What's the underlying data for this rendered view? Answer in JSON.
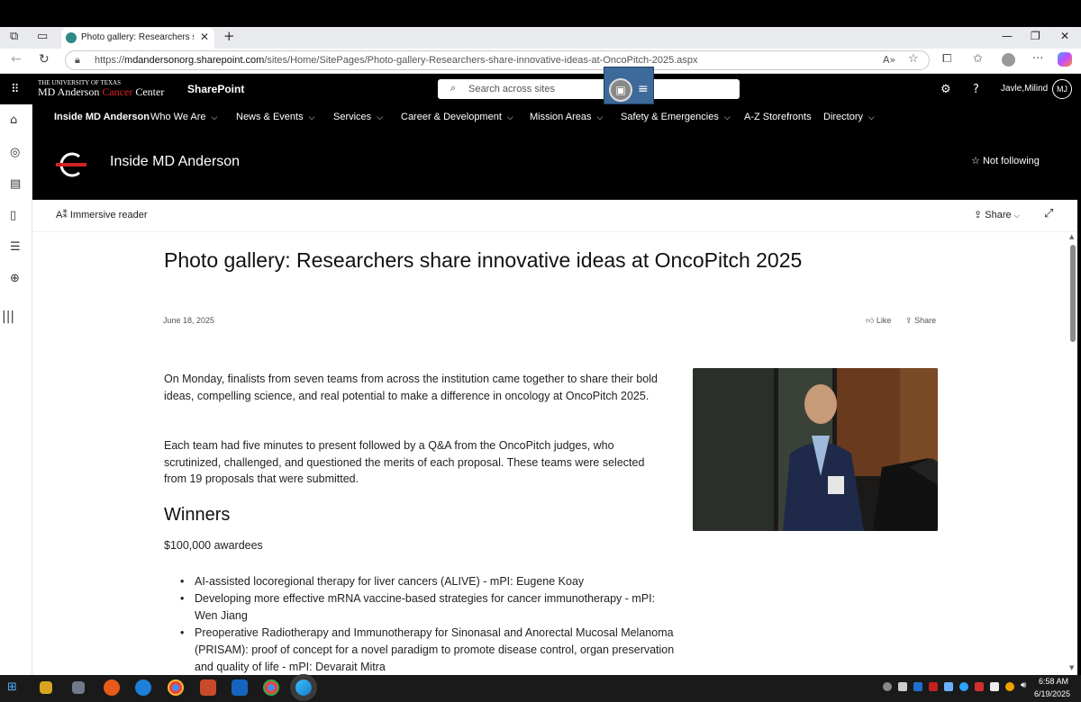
{
  "browser": {
    "tab_title": "Photo gallery: Researchers share i",
    "url_prefix": "https://",
    "url_domain": "mdandersonorg.sharepoint.com",
    "url_path": "/sites/Home/SitePages/Photo-gallery-Researchers-share-innovative-ideas-at-OncoPitch-2025.aspx"
  },
  "suite": {
    "logo_small": "THE UNIVERSITY OF TEXAS",
    "logo_md": "MD Anderson ",
    "logo_cancer": "Cancer",
    "logo_center": " Center",
    "app_name": "SharePoint",
    "search_placeholder": "Search across sites",
    "user_name": "Javle,Milind",
    "user_initials": "MJ"
  },
  "sitenav": {
    "items": [
      {
        "label": "Inside MD Anderson"
      },
      {
        "label": "Who We Are"
      },
      {
        "label": "News & Events"
      },
      {
        "label": "Services"
      },
      {
        "label": "Career & Development"
      },
      {
        "label": "Mission Areas"
      },
      {
        "label": "Safety & Emergencies"
      },
      {
        "label": "A-Z Storefronts"
      },
      {
        "label": "Directory"
      }
    ]
  },
  "site": {
    "title": "Inside MD Anderson",
    "follow_label": "Not following"
  },
  "commandbar": {
    "immersive_reader": "Immersive reader",
    "share": "Share"
  },
  "article": {
    "title": "Photo gallery: Researchers share innovative ideas at OncoPitch 2025",
    "date": "June 18, 2025",
    "like": "Like",
    "share": "Share",
    "para1": "On Monday, finalists from seven teams from across the institution came together to share their bold ideas, compelling science, and real potential to make a difference in oncology at OncoPitch 2025.",
    "para2": "Each team had five minutes to present followed by a Q&A from the OncoPitch judges, who scrutinized, challenged, and questioned the merits of each proposal. These teams were selected from 19 proposals that were submitted.",
    "winners_heading": "Winners",
    "awardees": "$100,000 awardees",
    "list": [
      "AI-assisted locoregional therapy for liver cancers (ALIVE) - mPI: Eugene Koay",
      "Developing more effective mRNA vaccine-based strategies for cancer immunotherapy - mPI: Wen Jiang",
      "Preoperative Radiotherapy and Immunotherapy for Sinonasal and Anorectal Mucosal Melanoma (PRISAM): proof of concept for a novel paradigm to promote disease control, organ preservation and quality of life - mPI: Devarait Mitra"
    ]
  },
  "taskbar": {
    "time": "6:58 AM",
    "date": "6/19/2025"
  },
  "colors": {
    "sp_black": "#000000",
    "mda_red": "#d22222",
    "link_gray": "#555555"
  }
}
